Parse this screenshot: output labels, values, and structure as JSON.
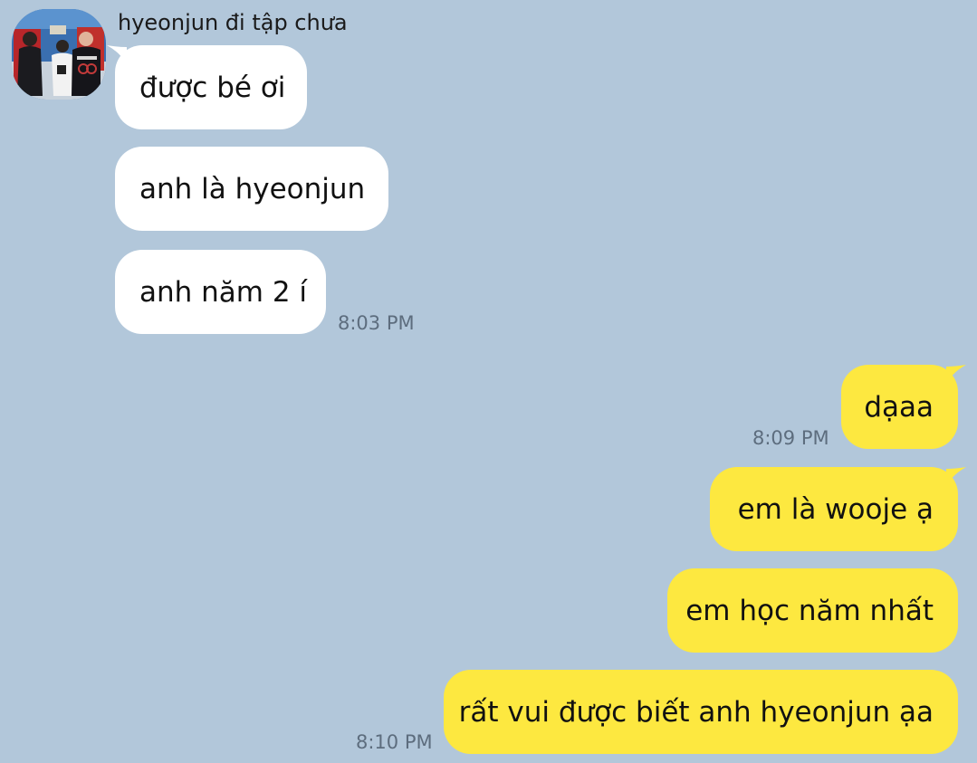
{
  "colors": {
    "background": "#b2c7da",
    "incoming_bubble": "#ffffff",
    "outgoing_bubble": "#fde840",
    "timestamp": "#5d6d7e"
  },
  "sender": {
    "name": "hyeonjun đi tập chưa",
    "avatar_icon": "profile-photo"
  },
  "incoming": [
    {
      "text": "được bé ơi"
    },
    {
      "text": "anh là hyeonjun"
    },
    {
      "text": "anh năm 2 í",
      "time": "8:03 PM"
    }
  ],
  "outgoing": [
    {
      "text": "dạaa",
      "time": "8:09 PM"
    },
    {
      "text": "em là wooje ạ"
    },
    {
      "text": "em học năm nhất"
    },
    {
      "text": "rất vui được biết anh hyeonjun ạa",
      "time": "8:10 PM"
    }
  ]
}
